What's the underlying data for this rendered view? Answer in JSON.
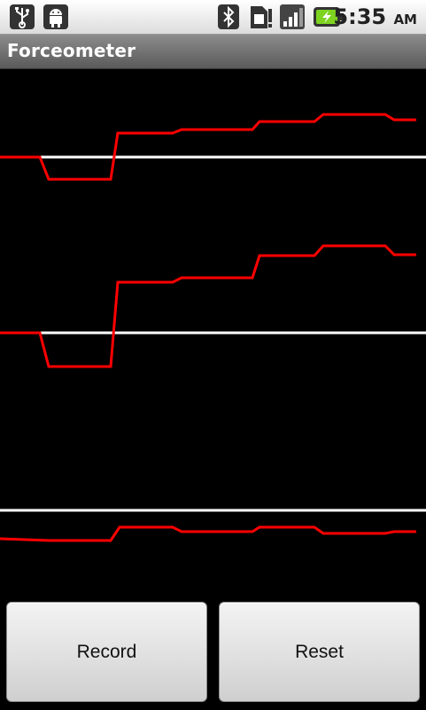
{
  "status_bar": {
    "time": "5:35",
    "ampm": "AM",
    "icons_left": [
      "usb-icon",
      "android-debug-icon"
    ],
    "icons_right": [
      "bluetooth-icon",
      "sim-alert-icon",
      "signal-icon",
      "battery-charging-icon"
    ]
  },
  "app": {
    "title": "Forceometer"
  },
  "graphs": [
    {
      "name": "top-graph",
      "line_color": "#ff0000",
      "baseline_color": "#ffffff",
      "points": [
        [
          0,
          0
        ],
        [
          45,
          0
        ],
        [
          55,
          -25
        ],
        [
          125,
          -25
        ],
        [
          133,
          27
        ],
        [
          195,
          27
        ],
        [
          205,
          31
        ],
        [
          285,
          31
        ],
        [
          293,
          40
        ],
        [
          355,
          40
        ],
        [
          365,
          48
        ],
        [
          435,
          48
        ],
        [
          445,
          42
        ],
        [
          470,
          42
        ]
      ]
    },
    {
      "name": "middle-graph",
      "line_color": "#ff0000",
      "baseline_color": "#ffffff",
      "points": [
        [
          0,
          0
        ],
        [
          45,
          0
        ],
        [
          55,
          -38
        ],
        [
          125,
          -38
        ],
        [
          133,
          57
        ],
        [
          195,
          57
        ],
        [
          205,
          62
        ],
        [
          285,
          62
        ],
        [
          293,
          87
        ],
        [
          355,
          87
        ],
        [
          365,
          98
        ],
        [
          435,
          98
        ],
        [
          445,
          88
        ],
        [
          470,
          88
        ]
      ]
    },
    {
      "name": "bottom-graph",
      "line_color": "#ff0000",
      "baseline_color": "#ffffff",
      "points": [
        [
          0,
          -32
        ],
        [
          55,
          -34
        ],
        [
          125,
          -34
        ],
        [
          135,
          -19
        ],
        [
          195,
          -19
        ],
        [
          205,
          -24
        ],
        [
          285,
          -24
        ],
        [
          293,
          -19
        ],
        [
          355,
          -19
        ],
        [
          365,
          -26
        ],
        [
          435,
          -26
        ],
        [
          445,
          -24
        ],
        [
          470,
          -24
        ]
      ]
    }
  ],
  "buttons": {
    "record_label": "Record",
    "reset_label": "Reset"
  }
}
